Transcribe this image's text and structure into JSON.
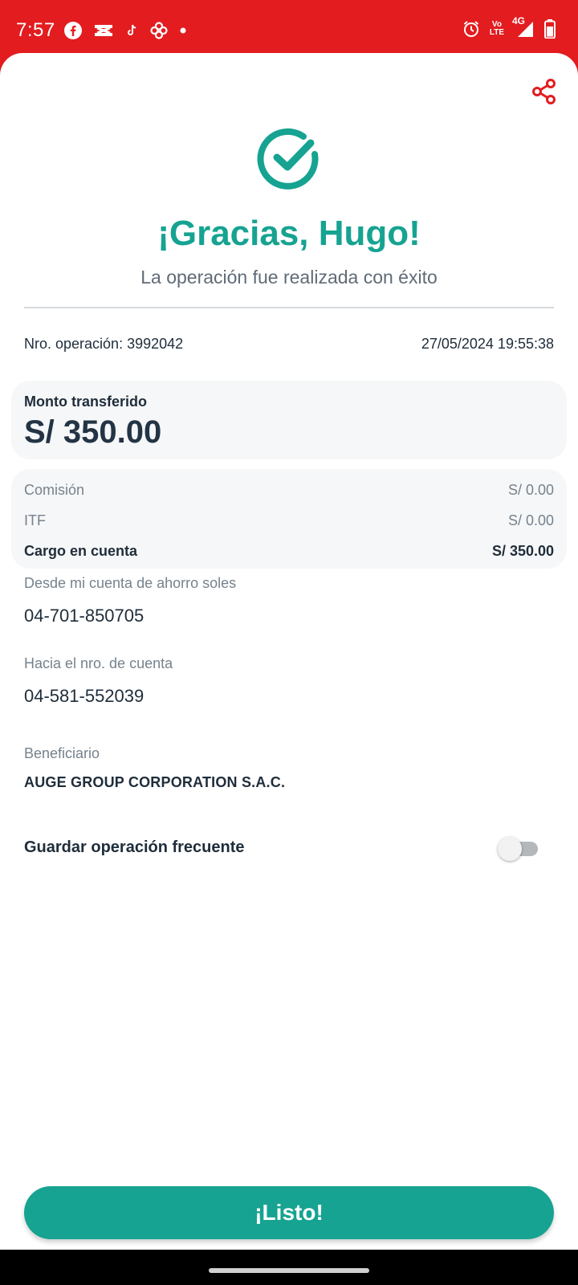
{
  "status_bar": {
    "time": "7:57",
    "left_icons": [
      "facebook-icon",
      "capcut-icon",
      "tiktok-icon",
      "pinwheel-icon",
      "dot-icon"
    ],
    "right_icons": [
      "alarm-icon",
      "volte-icon",
      "4g-signal-icon",
      "battery-icon"
    ],
    "volte_top": "Vo",
    "volte_bottom": "LTE",
    "network": "4G"
  },
  "header": {
    "share_icon": "share-icon",
    "success_icon": "check-circle-icon",
    "title": "¡Gracias, Hugo!",
    "subtitle": "La operación fue realizada con éxito"
  },
  "operation": {
    "number_label": "Nro. operación: 3992042",
    "datetime": "27/05/2024 19:55:38"
  },
  "amount": {
    "label": "Monto transferido",
    "value": "S/ 350.00"
  },
  "fees": {
    "commission_label": "Comisión",
    "commission_value": "S/ 0.00",
    "itf_label": "ITF",
    "itf_value": "S/ 0.00",
    "charge_label": "Cargo en cuenta",
    "charge_value": "S/ 350.00"
  },
  "from_account": {
    "label": "Desde mi cuenta de ahorro soles",
    "value": "04-701-850705"
  },
  "to_account": {
    "label": "Hacia el nro. de cuenta",
    "value": "04-581-552039"
  },
  "beneficiary": {
    "label": "Beneficiario",
    "value": "AUGE GROUP CORPORATION S.A.C."
  },
  "frequent": {
    "label": "Guardar operación frecuente",
    "enabled": false
  },
  "actions": {
    "done_label": "¡Listo!"
  },
  "colors": {
    "brand_red": "#e31c1f",
    "accent_teal": "#16a391",
    "text_dark": "#1f2d3a",
    "text_muted": "#75828d"
  }
}
